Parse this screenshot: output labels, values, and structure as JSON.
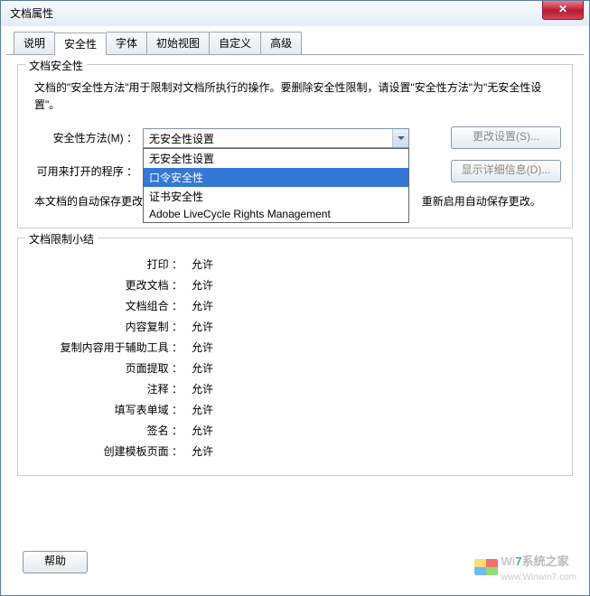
{
  "window": {
    "title": "文档属性"
  },
  "tabs": [
    "说明",
    "安全性",
    "字体",
    "初始视图",
    "自定义",
    "高级"
  ],
  "active_tab": 1,
  "security": {
    "group_title": "文档安全性",
    "desc": "文档的\"安全性方法\"用于限制对文档所执行的操作。要删除安全性限制，请设置\"安全性方法\"为\"无安全性设置\"。",
    "method_label": "安全性方法(M) ：",
    "method_value": "无安全性设置",
    "method_options": [
      "无安全性设置",
      "口令安全性",
      "证书安全性",
      "Adobe LiveCycle Rights Management"
    ],
    "method_selected_index": 1,
    "change_btn": "更改设置(S)...",
    "open_label": "可用来打开的程序 ：",
    "details_btn": "显示详细信息(D)...",
    "autosave_left": "本文档的自动保存更改功",
    "autosave_right": "重新启用自动保存更改。"
  },
  "restrictions": {
    "group_title": "文档限制小结",
    "allow": "允许",
    "items": [
      "打印 ：",
      "更改文档 ：",
      "文档组合 ：",
      "内容复制 ：",
      "复制内容用于辅助工具 ：",
      "页面提取 ：",
      "注释 ：",
      "填写表单域 ：",
      "签名 ：",
      "创建模板页面 ："
    ]
  },
  "help_btn": "帮助",
  "watermark": {
    "brand_left": "Wi",
    "brand_mid": "7",
    "brand_right": "系统之家",
    "url": "www.Winwin7.com"
  }
}
